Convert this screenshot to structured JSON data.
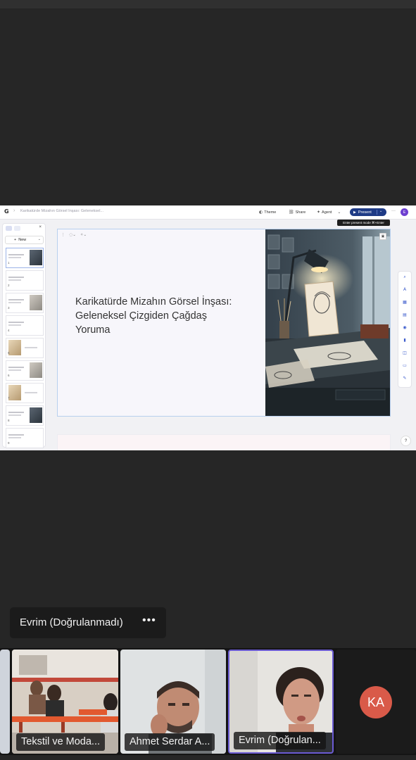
{
  "app": {
    "logo": "G",
    "breadcrumb_sep": "›",
    "doc_title": "Karikatürde Mizahın Görsel İnşası: Geleneksel..."
  },
  "toolbar": {
    "theme_label": "Theme",
    "share_label": "Share",
    "agent_label": "Agent",
    "present_label": "Present",
    "present_tooltip": "Enter present mode  ⌘+Enter",
    "more": "···",
    "user_initial": "E"
  },
  "panel": {
    "new_label": "New",
    "close": "×",
    "slide_numbers": [
      "1",
      "2",
      "3",
      "4",
      "5",
      "6",
      "7",
      "8",
      "9"
    ]
  },
  "slide": {
    "title": "Karikatürde Mizahın Görsel İnşası: Geleneksel Çizgiden Çağdaş Yoruma"
  },
  "help": "?",
  "meeting": {
    "active_speaker": "Evrim (Doğrulanmadı)",
    "more": "•••",
    "participants": [
      {
        "name": "Tekstil ve Moda..."
      },
      {
        "name": "Ahmet Serdar A..."
      },
      {
        "name": "Evrim (Doğrulan..."
      },
      {
        "initials": "KA"
      }
    ]
  },
  "colors": {
    "present_button": "#1f3b86",
    "active_tile_border": "#6b5bd3",
    "ka_avatar": "#d95a49"
  }
}
